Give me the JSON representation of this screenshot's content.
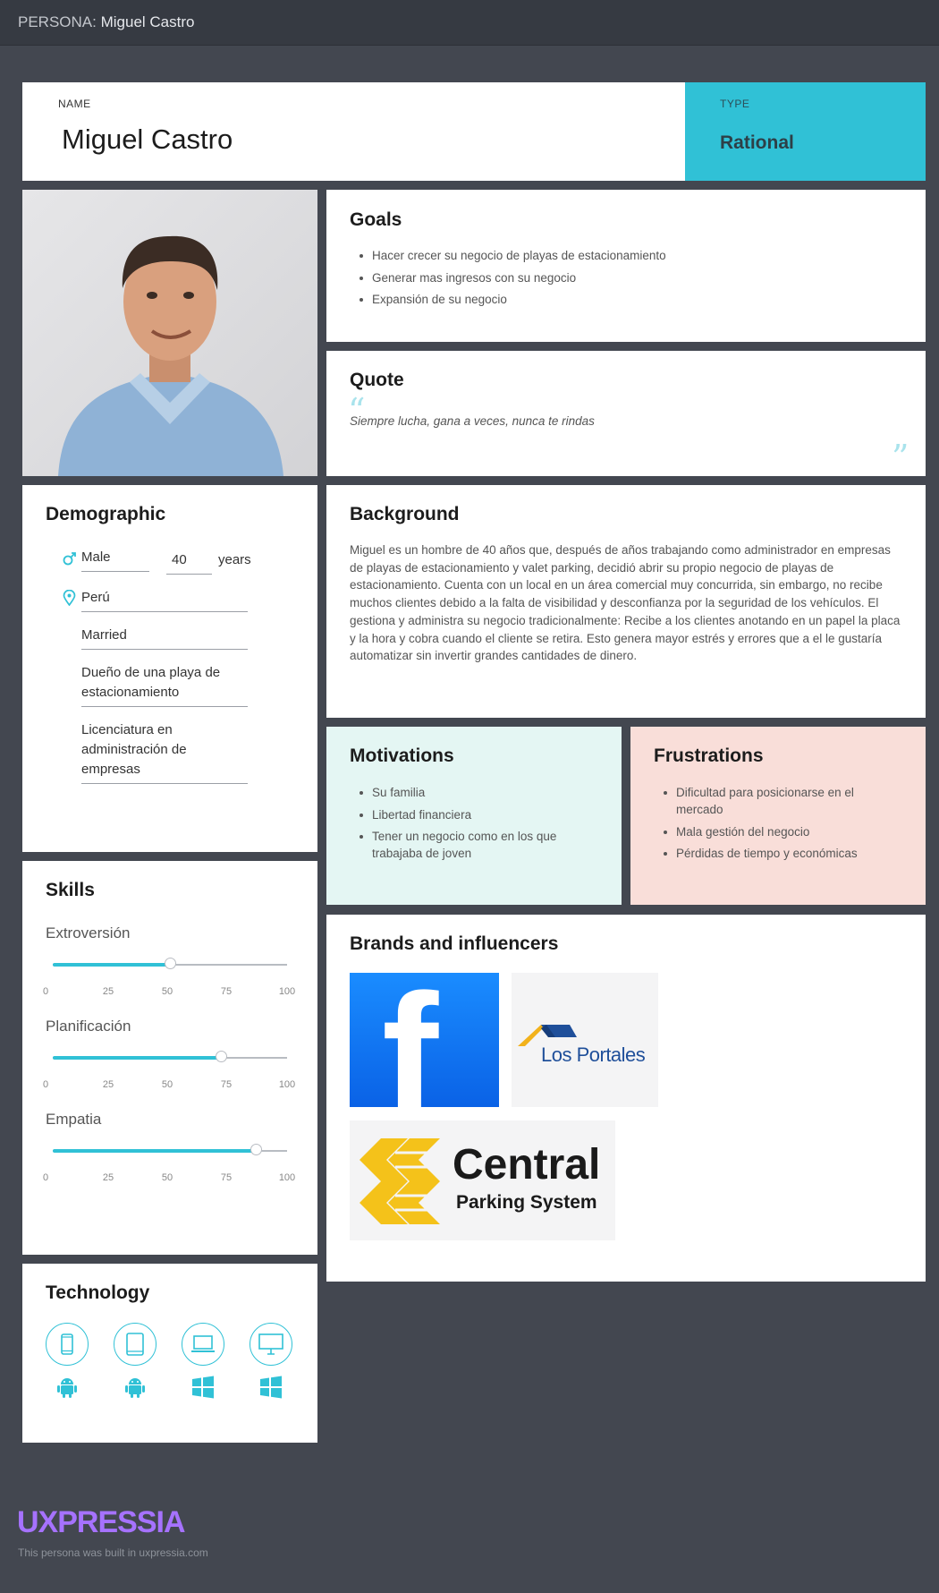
{
  "topbar": {
    "prefix": "PERSONA:",
    "name": "Miguel Castro"
  },
  "header": {
    "name_label": "NAME",
    "name": "Miguel Castro",
    "type_label": "TYPE",
    "type": "Rational"
  },
  "goals": {
    "title": "Goals",
    "items": [
      "Hacer crecer su negocio de playas de estacionamiento",
      "Generar mas ingresos con su negocio",
      "Expansión de su negocio"
    ]
  },
  "quote": {
    "title": "Quote",
    "text": "Siempre lucha, gana a veces, nunca te rindas"
  },
  "demographic": {
    "title": "Demographic",
    "gender": "Male",
    "age": "40",
    "age_unit": "years",
    "location": "Perú",
    "marital_status": "Married",
    "occupation": "Dueño de una playa de estacionamiento",
    "education": "Licenciatura en administración de empresas"
  },
  "background": {
    "title": "Background",
    "text": "Miguel es un hombre de 40 años que, después de años trabajando como administrador en empresas de playas de estacionamiento y valet parking, decidió abrir su propio negocio de playas de estacionamiento. Cuenta con un local en un área comercial muy concurrida, sin embargo, no recibe muchos clientes debido a la falta de visibilidad y desconfianza por la seguridad de los vehículos. El gestiona y administra su negocio tradicionalmente: Recibe a los clientes anotando en un papel la placa y la hora y cobra cuando el cliente se retira. Esto genera mayor estrés y errores que a el le gustaría automatizar sin invertir grandes cantidades de dinero."
  },
  "motivations": {
    "title": "Motivations",
    "items": [
      "Su familia",
      "Libertad financiera",
      "Tener un negocio como en los que trabajaba de joven"
    ]
  },
  "frustrations": {
    "title": "Frustrations",
    "items": [
      "Dificultad para posicionarse en el mercado",
      "Mala gestión del negocio",
      "Pérdidas de tiempo y económicas"
    ]
  },
  "skills": {
    "title": "Skills",
    "ticks": [
      "0",
      "25",
      "50",
      "75",
      "100"
    ],
    "items": [
      {
        "label": "Extroversión",
        "value": 50
      },
      {
        "label": "Planificación",
        "value": 72
      },
      {
        "label": "Empatia",
        "value": 87
      }
    ]
  },
  "brands": {
    "title": "Brands and influencers",
    "items": [
      {
        "name": "facebook",
        "text": "f"
      },
      {
        "name": "los-portales",
        "text": "Los Portales"
      },
      {
        "name": "central-parking",
        "text": "Central",
        "subtext": "Parking System"
      }
    ]
  },
  "technology": {
    "title": "Technology",
    "devices": [
      "mobile-icon",
      "tablet-icon",
      "laptop-icon",
      "desktop-icon"
    ],
    "os": [
      "android-icon",
      "android-icon",
      "windows-icon",
      "windows-icon"
    ]
  },
  "footer": {
    "brand": "UXPRESSIA",
    "note": "This persona was built in uxpressia.com"
  },
  "colors": {
    "accent": "#30c1d6",
    "background": "#434750",
    "motivations_bg": "#e4f6f3",
    "frustrations_bg": "#f9ded9",
    "brand": "#a672ff"
  }
}
